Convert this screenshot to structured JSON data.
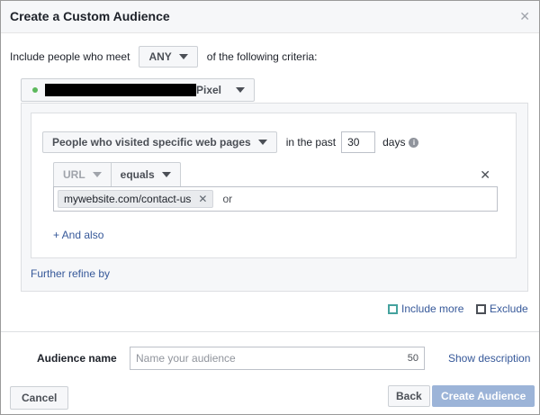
{
  "dialog": {
    "title": "Create a Custom Audience",
    "close_icon": "close-icon"
  },
  "criteria": {
    "prefix": "Include people who meet",
    "match_value": "ANY",
    "suffix": "of the following criteria:"
  },
  "pixel": {
    "label": "Pixel",
    "status_color": "#5cb85c"
  },
  "rule": {
    "visit_type": "People who visited specific web pages",
    "in_the_past": "in the past",
    "days_value": "30",
    "days_label": "days",
    "field": "URL",
    "operator": "equals",
    "token": "mywebsite.com/contact-us",
    "or_label": "or",
    "and_also": "+ And also"
  },
  "further_refine": "Further refine by",
  "actions": {
    "include_more": "Include more",
    "exclude": "Exclude"
  },
  "audience": {
    "label": "Audience name",
    "placeholder": "Name your audience",
    "char_count": "50",
    "show_description": "Show description"
  },
  "footer": {
    "cancel": "Cancel",
    "back": "Back",
    "create": "Create Audience",
    "create_color": "#9cb4d8"
  }
}
